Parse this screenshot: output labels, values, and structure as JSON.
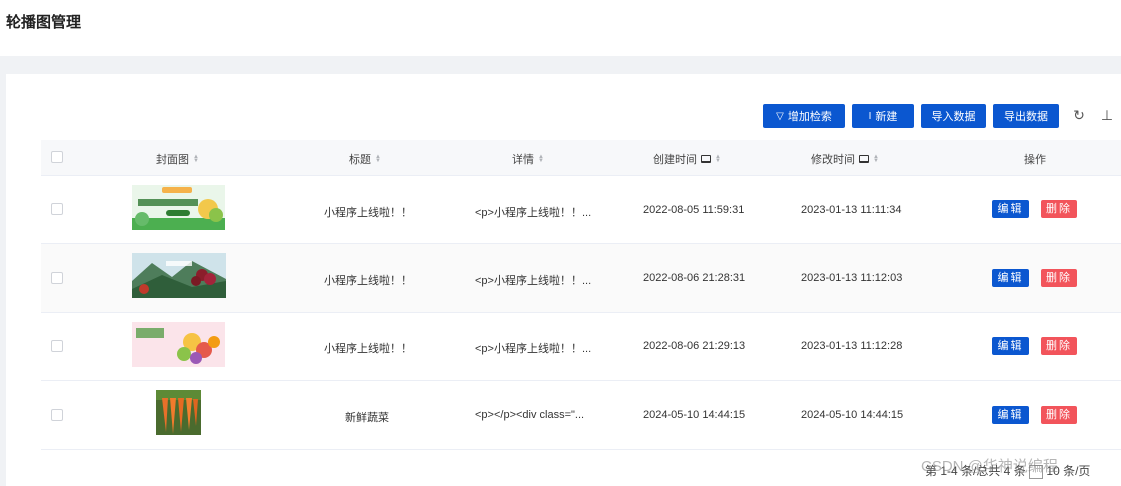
{
  "page": {
    "title": "轮播图管理"
  },
  "toolbar": {
    "search_label": "增加检索",
    "new_label": "新建",
    "import_label": "导入数据",
    "export_label": "导出数据",
    "filter_icon": "▽",
    "new_icon": "I",
    "refresh_icon": "↻",
    "density_icon": "⊥"
  },
  "table": {
    "headers": {
      "cover": "封面图",
      "title": "标题",
      "detail": "详情",
      "created": "创建时间",
      "modified": "修改时间",
      "actions": "操作"
    },
    "rows": [
      {
        "title": "小程序上线啦！！",
        "detail": "<p>小程序上线啦！！...",
        "created": "2022-08-05 11:59:31",
        "modified": "2023-01-13 11:11:34",
        "edit": "编辑",
        "delete": "删除"
      },
      {
        "title": "小程序上线啦！！",
        "detail": "<p>小程序上线啦！！...",
        "created": "2022-08-06 21:28:31",
        "modified": "2023-01-13 11:12:03",
        "edit": "编辑",
        "delete": "删除"
      },
      {
        "title": "小程序上线啦！！",
        "detail": "<p>小程序上线啦！！...",
        "created": "2022-08-06 21:29:13",
        "modified": "2023-01-13 11:12:28",
        "edit": "编辑",
        "delete": "删除"
      },
      {
        "title": "新鲜蔬菜",
        "detail": "<p></p><div class=\"...",
        "created": "2024-05-10 14:44:15",
        "modified": "2024-05-10 14:44:15",
        "edit": "编辑",
        "delete": "删除"
      }
    ]
  },
  "pagination": {
    "text": "第 1-4 条/总共 4 条",
    "page_size": "10 条/页"
  },
  "watermark": "CSDN @华神说编程",
  "colors": {
    "primary": "#0b57d0",
    "danger": "#f2545b",
    "header_bg": "#f7f8fa",
    "band_bg": "#f0f2f5"
  }
}
